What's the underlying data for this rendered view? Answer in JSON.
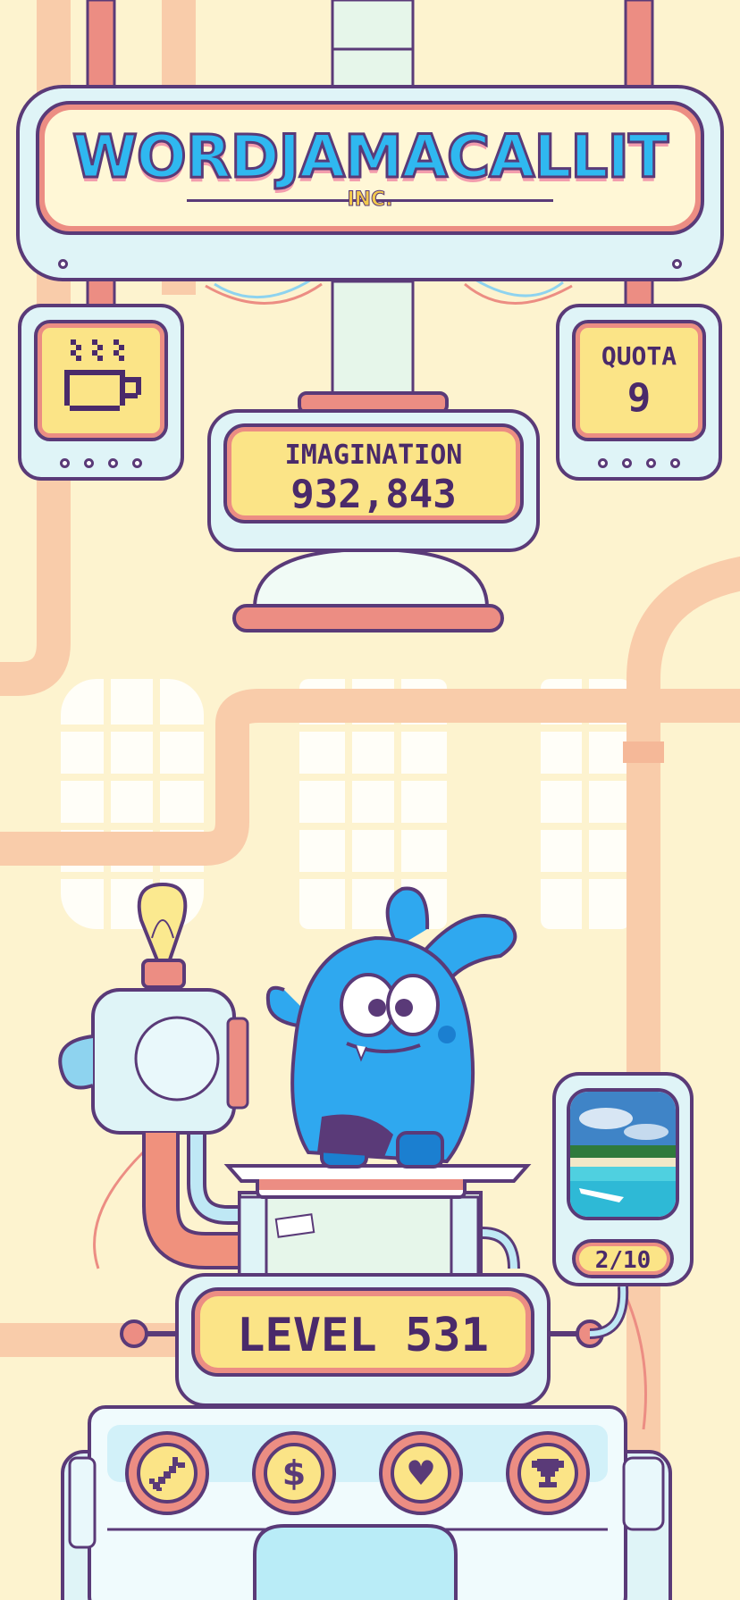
{
  "title": {
    "main": "Wordjamacallit",
    "sub": "INC."
  },
  "stats": {
    "imagination_label": "IMAGINATION",
    "imagination_value": "932,843",
    "quota_label": "QUOTA",
    "quota_value": "9"
  },
  "level": {
    "label": "LEVEL 531"
  },
  "photo_album": {
    "progress": "2/10"
  },
  "icons": {
    "coffee": "coffee-cup-icon",
    "tools": "wrench-icon",
    "shop": "dollar-icon",
    "likes": "heart-icon",
    "trophy": "trophy-icon"
  },
  "colors": {
    "background": "#fdf3cf",
    "outline": "#5a3a78",
    "screen": "#fbe487",
    "accent_red": "#ec8d83",
    "glass": "#dff4f7",
    "mascot": "#2fa8ef"
  }
}
